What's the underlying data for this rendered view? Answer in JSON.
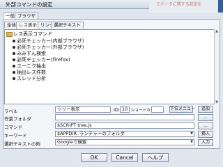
{
  "window": {
    "title": "外部コマンドの設定",
    "background_hint": "エディタに関する設定を"
  },
  "top_tabs": [
    "一般",
    "ブラウザ"
  ],
  "sub_tabs": [
    "全体",
    "レス表示",
    "リンク",
    "選択テキスト"
  ],
  "tree": {
    "root": "レス表示コマンド",
    "items": [
      "必死チェッカー(内部ブラウザ)",
      "必死チェッカー(外部ブラウザ)",
      "みみずん検索",
      "必死チェッカー(firefox)",
      "ユーニク抽出",
      "抽出レス件数",
      "スレッド分析"
    ]
  },
  "form": {
    "label": {
      "caption": "ラベル",
      "value": "ツリー表示"
    },
    "id": {
      "caption": "ID:",
      "value": "10"
    },
    "shortcut": {
      "caption": "ショートカット",
      "value": ""
    },
    "submenu_button": "下位メニュー",
    "add_button": "追加",
    "workdir": {
      "caption": "作業フォルダ",
      "value": ""
    },
    "browse1": "...",
    "command": {
      "caption": "コマンド",
      "value": "$SCRIPT tree.js"
    },
    "browse2": "...",
    "keyword": {
      "caption": "キーワード",
      "value": "$APPDIR: ランチャーのフォルダ"
    },
    "insert_button": "挿入",
    "example": {
      "caption": "選択テキストの例",
      "value": "Googleで検索"
    },
    "input_button": "入力"
  },
  "buttons": {
    "ok": "OK",
    "cancel": "Cancel",
    "help": "ヘルプ"
  }
}
